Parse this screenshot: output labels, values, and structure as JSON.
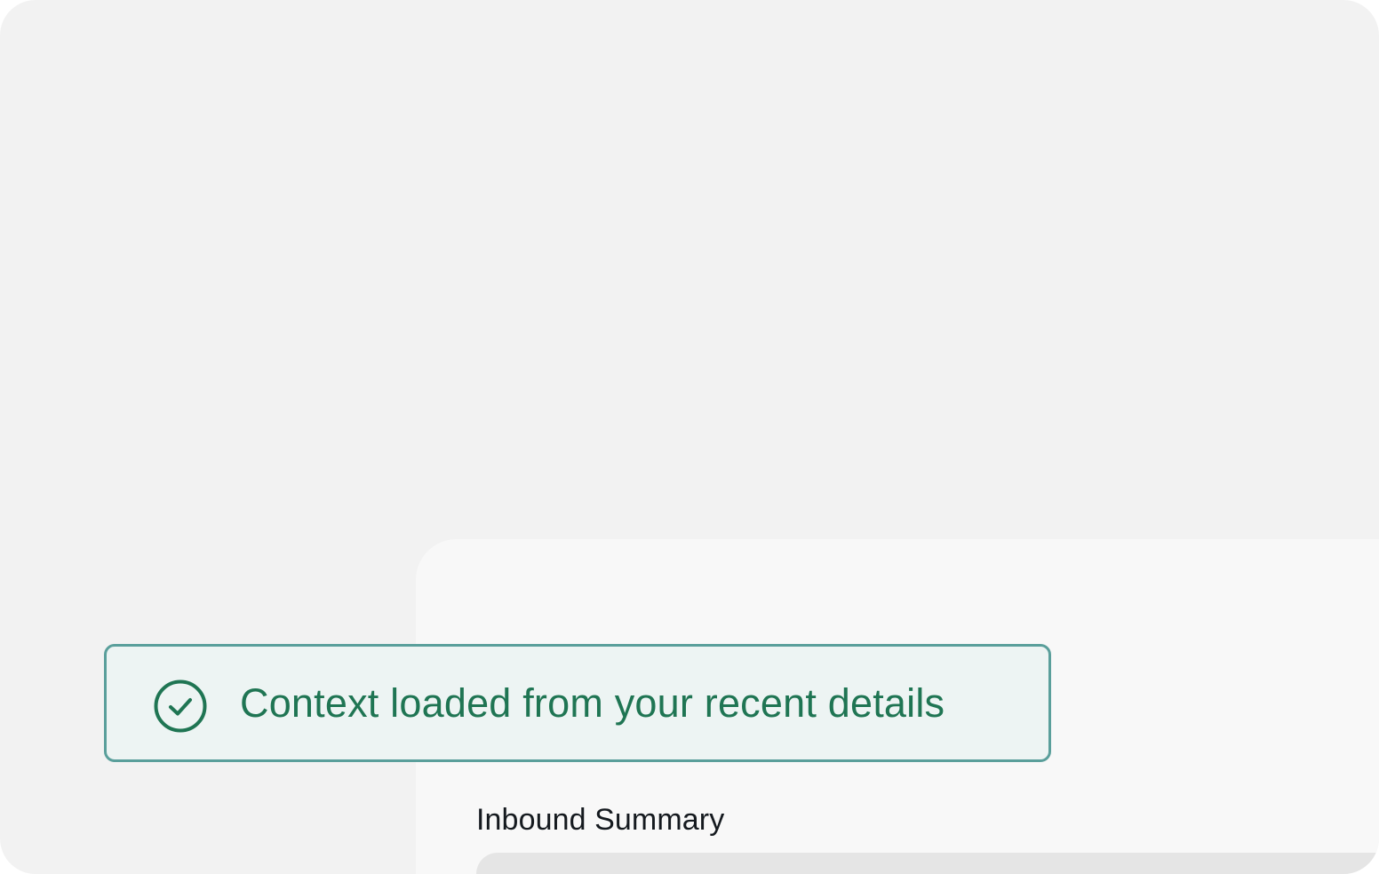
{
  "notification": {
    "message": "Context loaded from your recent details",
    "icon": "check-circle-icon",
    "text_color": "#1f7553",
    "border_color": "#5a9f9b",
    "background_color": "#edf4f3"
  },
  "main": {
    "section_title": "Inbound Summary"
  }
}
